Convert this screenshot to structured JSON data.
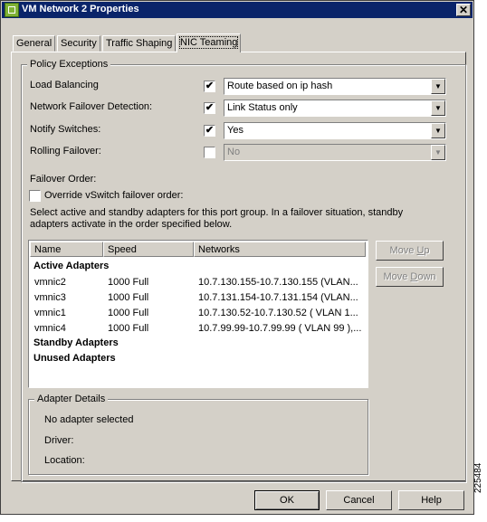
{
  "window": {
    "title": "VM Network 2 Properties",
    "close_glyph": "✕"
  },
  "tabs": [
    {
      "label": "General",
      "active": false
    },
    {
      "label": "Security",
      "active": false
    },
    {
      "label": "Traffic Shaping",
      "active": false
    },
    {
      "label": "NIC Teaming",
      "active": true
    }
  ],
  "policy": {
    "group_title": "Policy Exceptions",
    "rows": [
      {
        "label": "Load Balancing",
        "checked": true,
        "value": "Route based on ip hash",
        "enabled": true
      },
      {
        "label": "Network Failover Detection:",
        "checked": true,
        "value": "Link Status only",
        "enabled": true
      },
      {
        "label": "Notify Switches:",
        "checked": true,
        "value": "Yes",
        "enabled": true
      },
      {
        "label": "Rolling Failover:",
        "checked": false,
        "value": "No",
        "enabled": false
      }
    ],
    "failover_order_label": "Failover Order:",
    "override_label": "Override vSwitch failover order:",
    "override_checked": false,
    "description": "Select active and standby adapters for this port group.  In a failover situation, standby adapters activate  in the order specified below."
  },
  "adapters_table": {
    "columns": [
      "Name",
      "Speed",
      "Networks"
    ],
    "active_header": "Active Adapters",
    "rows": [
      {
        "name": "vmnic2",
        "speed": "1000 Full",
        "networks": "10.7.130.155-10.7.130.155 (VLAN..."
      },
      {
        "name": "vmnic3",
        "speed": "1000 Full",
        "networks": "10.7.131.154-10.7.131.154 (VLAN..."
      },
      {
        "name": "vmnic1",
        "speed": "1000 Full",
        "networks": "10.7.130.52-10.7.130.52 ( VLAN 1..."
      },
      {
        "name": "vmnic4",
        "speed": "1000 Full",
        "networks": "10.7.99.99-10.7.99.99 ( VLAN 99 ),..."
      }
    ],
    "standby_header": "Standby Adapters",
    "unused_header": "Unused Adapters"
  },
  "move_buttons": {
    "up_pre": "Move ",
    "up_u": "U",
    "up_post": "p",
    "down_pre": "Move ",
    "down_u": "D",
    "down_post": "own"
  },
  "adapter_details": {
    "group_title": "Adapter Details",
    "no_selection": "No adapter selected",
    "driver_label": "Driver:",
    "location_label": "Location:"
  },
  "footer": {
    "ok": "OK",
    "cancel": "Cancel",
    "help": "Help"
  },
  "figure_id": "225484",
  "check_glyph": "✔",
  "arrow_glyph": "▼"
}
